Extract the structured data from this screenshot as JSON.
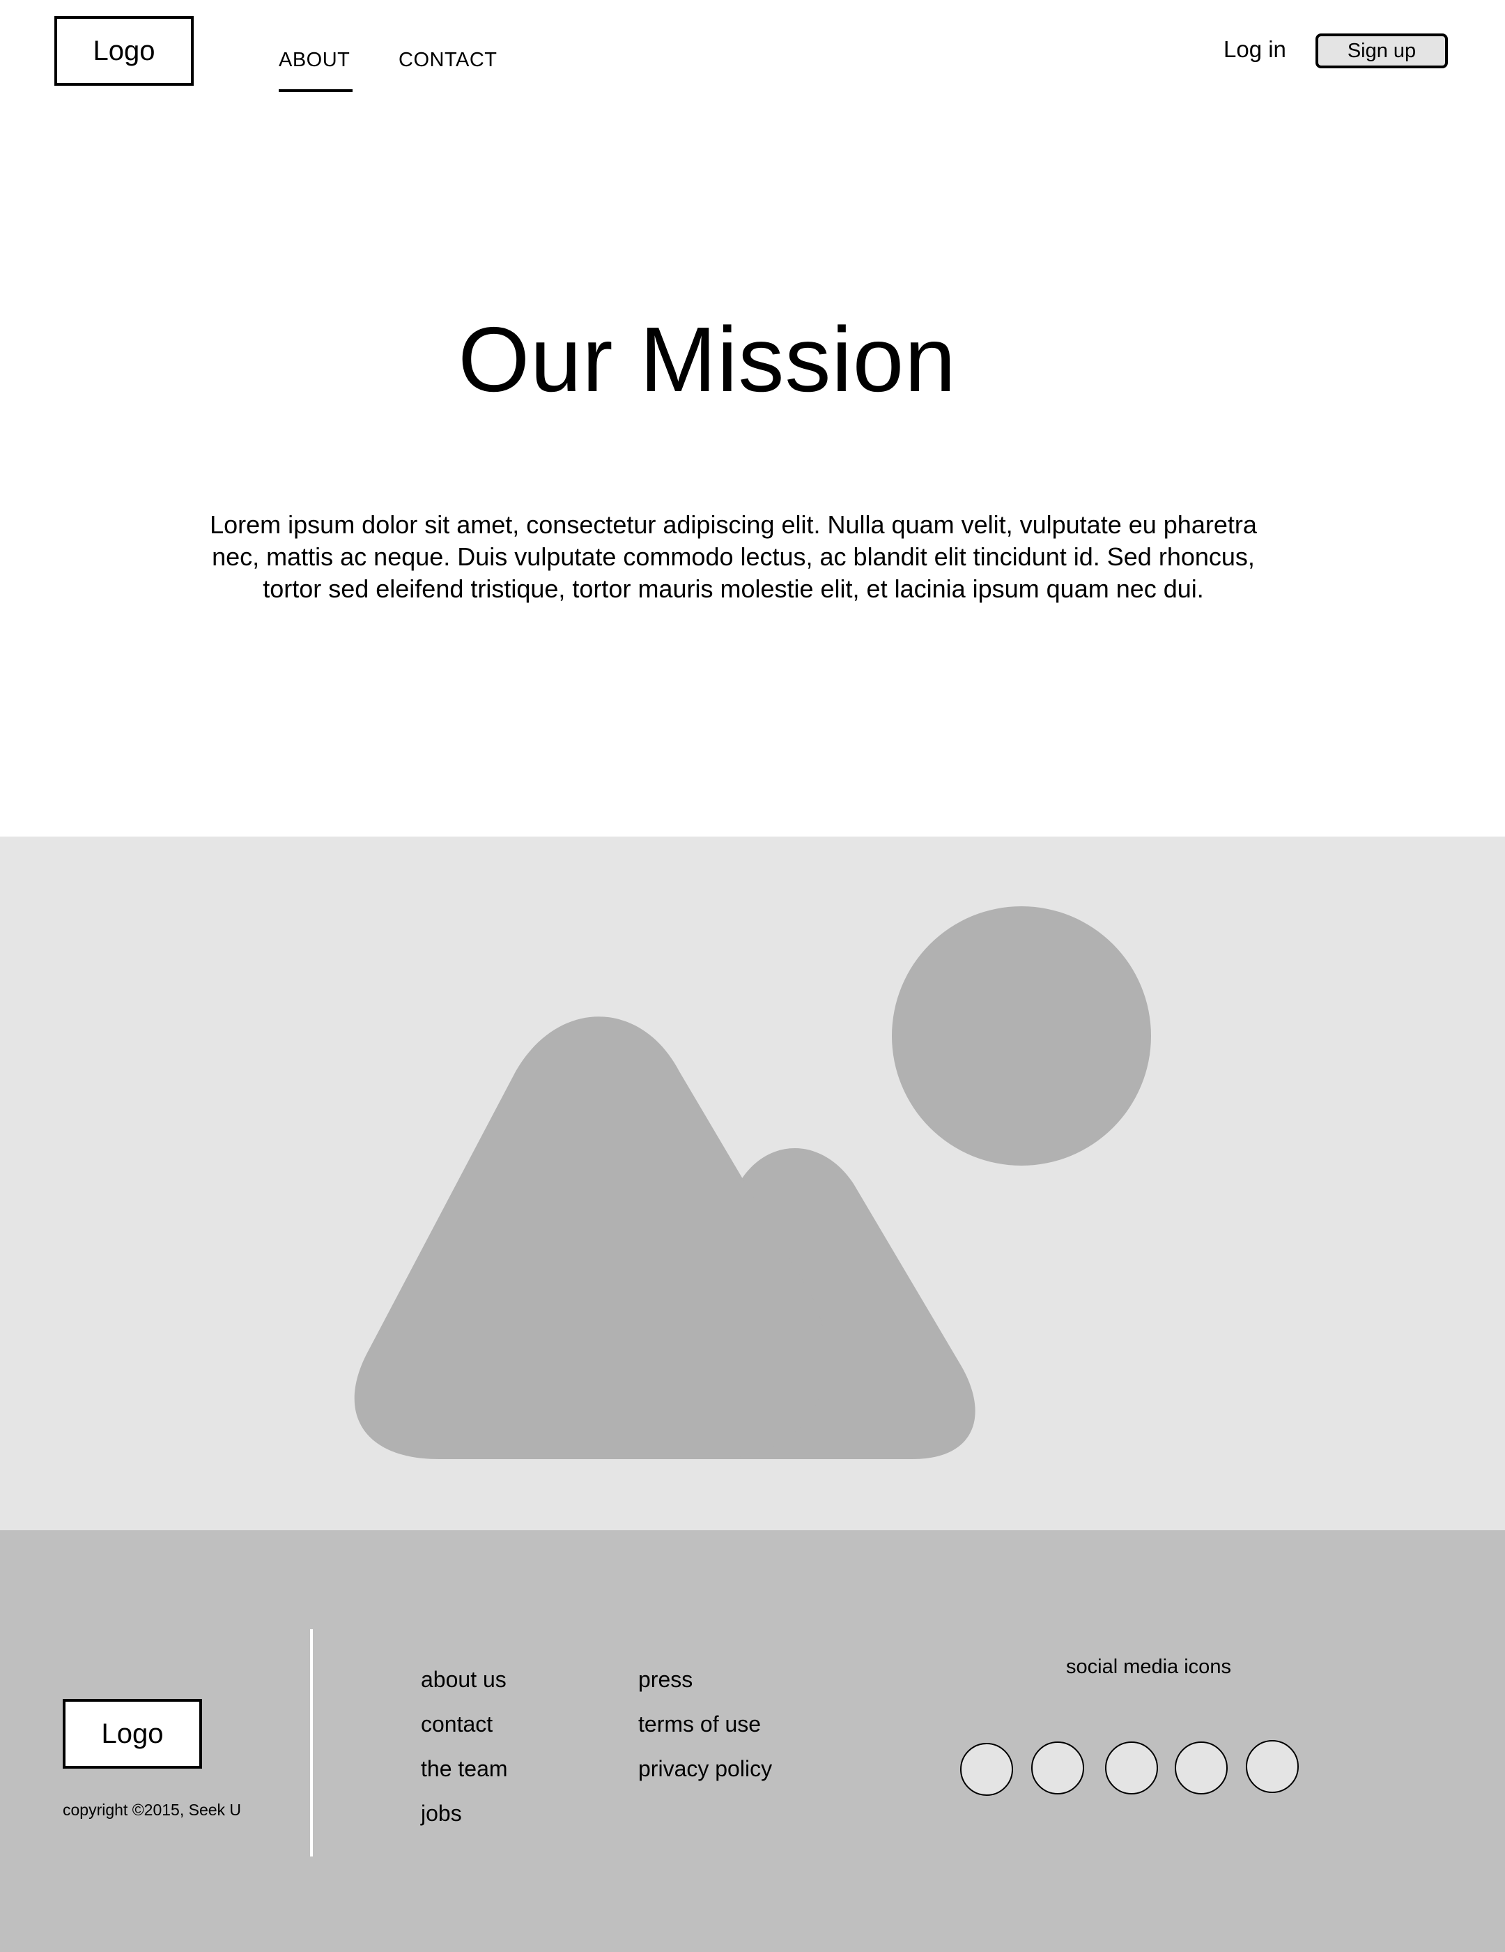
{
  "header": {
    "logo": "Logo",
    "nav": [
      {
        "label": "ABOUT",
        "active": true
      },
      {
        "label": "CONTACT",
        "active": false
      }
    ],
    "login": "Log in",
    "signup": "Sign up"
  },
  "hero": {
    "title": "Our Mission",
    "body": "Lorem ipsum dolor sit amet, consectetur adipiscing elit. Nulla quam velit, vulputate eu pharetra nec, mattis ac neque. Duis vulputate commodo lectus, ac blandit elit tincidunt id. Sed rhoncus, tortor sed eleifend tristique, tortor mauris molestie elit, et lacinia ipsum quam nec dui."
  },
  "image_placeholder": {
    "icons": [
      "mountain-icon",
      "sun-icon"
    ],
    "colors": {
      "background": "#e5e5e5",
      "shape": "#b1b1b1"
    }
  },
  "footer": {
    "logo": "Logo",
    "copyright": "copyright ©2015, Seek U",
    "links_col1": [
      "about us",
      "contact",
      "the team",
      "jobs"
    ],
    "links_col2": [
      "press",
      "terms of use",
      "privacy policy"
    ],
    "social_label": "social media icons",
    "social_icon_count": 5,
    "colors": {
      "background": "#bfbfbf",
      "divider": "#ffffff"
    }
  }
}
